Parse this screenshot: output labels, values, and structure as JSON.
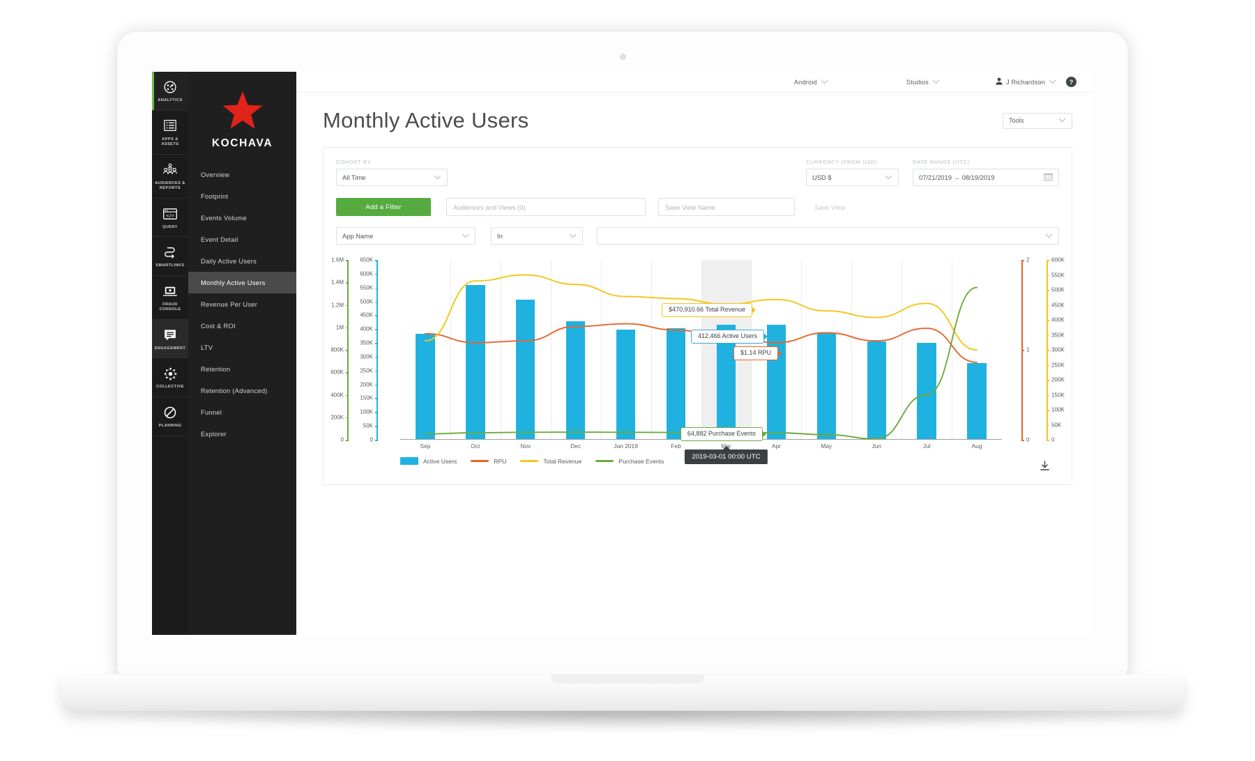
{
  "rail": {
    "items": [
      {
        "label": "ANALYTICS",
        "icon": "analytics-gauge-icon",
        "active": true
      },
      {
        "label": "APPS & ASSETS",
        "icon": "list-icon",
        "active": false
      },
      {
        "label": "AUDIENCES & REPORTS",
        "icon": "people-icon",
        "active": false
      },
      {
        "label": "QUERY",
        "icon": "code-window-icon",
        "active": false
      },
      {
        "label": "SMARTLINKS",
        "icon": "link-path-icon",
        "active": false
      },
      {
        "label": "FRAUD CONSOLE",
        "icon": "laptop-shield-icon",
        "active": false
      },
      {
        "label": "ENGAGEMENT",
        "icon": "message-icon",
        "active": false
      },
      {
        "label": "COLLECTIVE",
        "icon": "network-circle-icon",
        "active": false
      },
      {
        "label": "PLANNING",
        "icon": "no-entry-icon",
        "active": false
      }
    ]
  },
  "brand": {
    "name": "KOCHAVA",
    "logo": "red-star-logo"
  },
  "sidebar": {
    "items": [
      {
        "label": "Overview",
        "selected": false
      },
      {
        "label": "Footprint",
        "selected": false
      },
      {
        "label": "Events Volume",
        "selected": false
      },
      {
        "label": "Event Detail",
        "selected": false
      },
      {
        "label": "Daily Active Users",
        "selected": false
      },
      {
        "label": "Monthly Active Users",
        "selected": true
      },
      {
        "label": "Revenue Per User",
        "selected": false
      },
      {
        "label": "Cost & ROI",
        "selected": false
      },
      {
        "label": "LTV",
        "selected": false
      },
      {
        "label": "Retention",
        "selected": false
      },
      {
        "label": "Retention (Advanced)",
        "selected": false
      },
      {
        "label": "Funnel",
        "selected": false
      },
      {
        "label": "Explorer",
        "selected": false
      }
    ]
  },
  "topbar": {
    "platform": "Android",
    "account": "Studios",
    "user": "J Richardson",
    "help_label": "?"
  },
  "header": {
    "title": "Monthly Active Users",
    "tools_label": "Tools"
  },
  "filters": {
    "cohort_label": "COHORT BY",
    "cohort_value": "All Time",
    "currency_label": "CURRENCY (FROM USD)",
    "currency_value": "USD $",
    "date_label": "DATE RANGE (UTC)",
    "date_value": "07/21/2019 → 08/19/2019",
    "add_filter_label": "Add a Filter",
    "audiences_placeholder": "Audiences and Views (0)",
    "save_view_name_placeholder": "Save View Name",
    "save_view_label": "Save View",
    "field_value": "App Name",
    "operator_value": "In",
    "value_value": ""
  },
  "chart_data": {
    "type": "bar",
    "title": "Monthly Active Users",
    "categories": [
      "Sep",
      "Oct",
      "Nov",
      "Dec",
      "Jan 2019",
      "Feb",
      "Mar",
      "Apr",
      "May",
      "Jun",
      "Jul",
      "Aug"
    ],
    "grid": true,
    "legend_position": "bottom",
    "axes": [
      {
        "name": "Purchase Events",
        "side": "left",
        "color": "#6aab3a",
        "ylim": [
          0,
          1600000
        ],
        "ticks": [
          "0",
          "200K",
          "400K",
          "600K",
          "800K",
          "1M",
          "1.2M",
          "1.4M",
          "1.6M"
        ]
      },
      {
        "name": "Active Users",
        "side": "left",
        "color": "#1fb2e0",
        "ylim": [
          0,
          650000
        ],
        "ticks": [
          "0",
          "50K",
          "100K",
          "150K",
          "200K",
          "250K",
          "300K",
          "350K",
          "400K",
          "450K",
          "500K",
          "550K",
          "600K",
          "650K"
        ]
      },
      {
        "name": "RPU",
        "side": "right",
        "color": "#e8642a",
        "ylim": [
          0,
          2
        ],
        "ticks": [
          "0",
          "1",
          "2"
        ]
      },
      {
        "name": "Total Revenue",
        "side": "right",
        "color": "#f5c518",
        "ylim": [
          0,
          600000
        ],
        "ticks": [
          "0",
          "50K",
          "100K",
          "150K",
          "200K",
          "250K",
          "300K",
          "350K",
          "400K",
          "450K",
          "500K",
          "550K",
          "600K"
        ]
      }
    ],
    "series": [
      {
        "name": "Active Users",
        "type": "bar",
        "color": "#1fb2e0",
        "axis": "Active Users",
        "values": [
          380000,
          557000,
          505000,
          425000,
          396000,
          400000,
          412466,
          413000,
          383000,
          352000,
          348000,
          275000
        ]
      },
      {
        "name": "RPU",
        "type": "line",
        "color": "#e8642a",
        "axis": "RPU",
        "values": [
          1.18,
          1.08,
          1.1,
          1.26,
          1.29,
          1.22,
          1.14,
          1.08,
          1.19,
          1.1,
          1.24,
          0.86
        ]
      },
      {
        "name": "Total Revenue",
        "type": "line",
        "color": "#f5c518",
        "axis": "Total Revenue",
        "values": [
          330000,
          530000,
          550000,
          518000,
          478000,
          470910.66,
          452000,
          468000,
          430000,
          408000,
          455000,
          300000
        ]
      },
      {
        "name": "Purchase Events",
        "type": "line",
        "color": "#6aab3a",
        "axis": "Purchase Events",
        "values": [
          52000,
          62000,
          66000,
          68000,
          66000,
          65000,
          64882,
          62000,
          45000,
          8000,
          400000,
          1355000
        ]
      }
    ],
    "legend": [
      "Active Users",
      "RPU",
      "Total Revenue",
      "Purchase Events"
    ],
    "callouts": [
      {
        "id": "revenue",
        "text": "$470,910.66 Total Revenue",
        "color": "#f5c518"
      },
      {
        "id": "users",
        "text": "412,466 Active Users",
        "color": "#3aa8d8"
      },
      {
        "id": "rpu",
        "text": "$1.14 RPU",
        "color": "#e8642a"
      },
      {
        "id": "events",
        "text": "64,882 Purchase Events",
        "color": "#6aab3a"
      }
    ],
    "hover_tooltip": "2019-03-01 00:00 UTC"
  },
  "chart_footer": {
    "download_icon": "download-icon"
  }
}
